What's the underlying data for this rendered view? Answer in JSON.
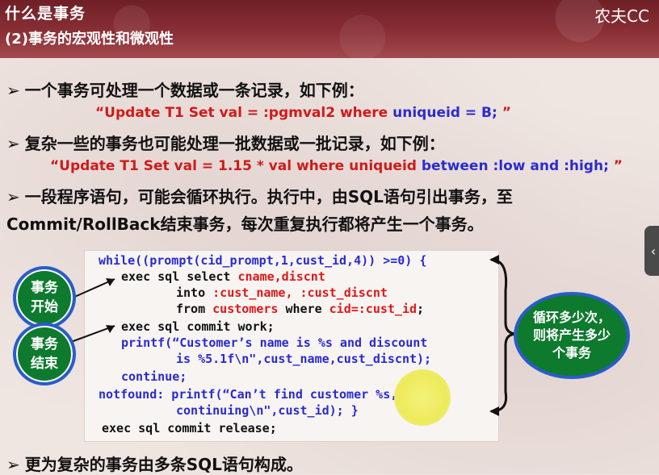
{
  "header": {
    "title": "什么是事务",
    "subtitle": "(2)事务的宏观性和微观性",
    "brand": "农夫CC"
  },
  "bullets": {
    "b1": "一个事务可处理一个数据或一条记录，如下例：",
    "b2": "复杂一些的事务也可能处理一批数据或一批记录，如下例：",
    "b3a": "一段程序语句，可能会循环执行。执行中，由SQL语句引出事务，至",
    "b3b": "Commit/RollBack结束事务，每次重复执行都将产生一个事务。",
    "b4": "更为复杂的事务由多条SQL语句构成。",
    "arrow": "➢"
  },
  "examples": {
    "ex1_red": "“Update T1 Set val = :pgmval2  where ",
    "ex1_blue": "uniqueid = B; ",
    "ex1_end": "”",
    "ex2_red": "“Update T1 Set val = 1.15 * val  where  uniqueid ",
    "ex2_blue": "between :low  and :high; ",
    "ex2_end": "”"
  },
  "code": {
    "l1": "while((prompt(cid_prompt,1,cust_id,4)) >=0) {",
    "l2a": "exec sql select ",
    "l2b": "cname,discnt",
    "l3a": "into ",
    "l3b": ":cust_name, :cust_discnt",
    "l4a": "from ",
    "l4b": "customers",
    "l4c": " where ",
    "l4d": "cid=:cust_id",
    "l4e": ";",
    "l5": "exec sql commit work;",
    "l6a": "printf(“Customer’s name is %s and discount",
    "l7a": "is %5.1f\\n\",cust_name,cust_discnt);",
    "l8": "continue;",
    "l9a": "notfound: printf(“Can’t find customer %s,",
    "l10a": "continuing\\n\",cust_id); }",
    "l11": "exec sql  commit release;"
  },
  "badges": {
    "start_1": "事务",
    "start_2": "开始",
    "end_1": "事务",
    "end_2": "结束",
    "loop_1": "循环多少次，",
    "loop_2": "则将产生多少",
    "loop_3": "个事务"
  },
  "colors": {
    "header_bg": "#8a2f36",
    "badge_green": "#0e7a2e",
    "badge_border": "#2a5cc9",
    "code_red": "#e01818",
    "code_blue": "#2a2ad0"
  }
}
